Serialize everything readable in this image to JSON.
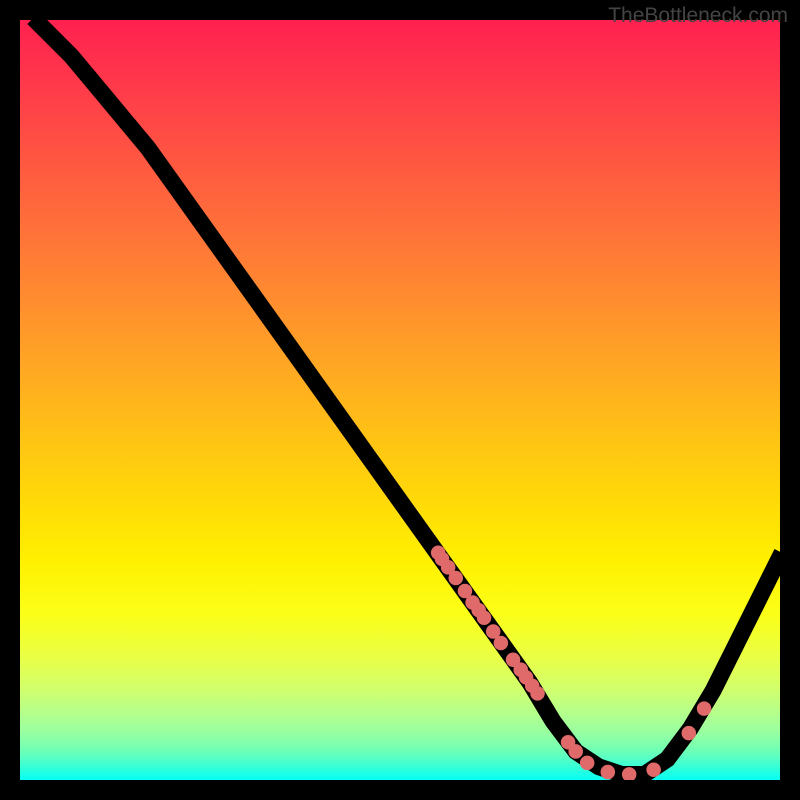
{
  "watermark": "TheBottleneck.com",
  "chart_data": {
    "type": "line",
    "title": "",
    "xlabel": "",
    "ylabel": "",
    "xlim": [
      0,
      100
    ],
    "ylim": [
      0,
      100
    ],
    "grid": false,
    "legend": false,
    "curve": [
      {
        "x": 2,
        "y": 100
      },
      {
        "x": 7,
        "y": 95
      },
      {
        "x": 12,
        "y": 89
      },
      {
        "x": 17,
        "y": 83
      },
      {
        "x": 22,
        "y": 76
      },
      {
        "x": 27,
        "y": 69
      },
      {
        "x": 32,
        "y": 62
      },
      {
        "x": 37,
        "y": 55
      },
      {
        "x": 42,
        "y": 48
      },
      {
        "x": 47,
        "y": 41
      },
      {
        "x": 52,
        "y": 34
      },
      {
        "x": 57,
        "y": 27
      },
      {
        "x": 62,
        "y": 20
      },
      {
        "x": 67,
        "y": 13
      },
      {
        "x": 70,
        "y": 8
      },
      {
        "x": 73,
        "y": 4
      },
      {
        "x": 76,
        "y": 2
      },
      {
        "x": 79,
        "y": 1
      },
      {
        "x": 82,
        "y": 1
      },
      {
        "x": 85,
        "y": 3
      },
      {
        "x": 88,
        "y": 7
      },
      {
        "x": 91,
        "y": 12
      },
      {
        "x": 94,
        "y": 18
      },
      {
        "x": 97,
        "y": 24
      },
      {
        "x": 100,
        "y": 30
      }
    ],
    "markers": [
      {
        "x": 55.0,
        "y": 30.0
      },
      {
        "x": 55.5,
        "y": 29.2
      },
      {
        "x": 56.3,
        "y": 28.1
      },
      {
        "x": 57.3,
        "y": 26.7
      },
      {
        "x": 58.5,
        "y": 25.0
      },
      {
        "x": 59.5,
        "y": 23.5
      },
      {
        "x": 60.3,
        "y": 22.5
      },
      {
        "x": 61.0,
        "y": 21.5
      },
      {
        "x": 62.2,
        "y": 19.7
      },
      {
        "x": 63.2,
        "y": 18.2
      },
      {
        "x": 64.8,
        "y": 16.0
      },
      {
        "x": 65.8,
        "y": 14.7
      },
      {
        "x": 66.5,
        "y": 13.7
      },
      {
        "x": 67.3,
        "y": 12.6
      },
      {
        "x": 68.0,
        "y": 11.6
      },
      {
        "x": 72.0,
        "y": 5.2
      },
      {
        "x": 73.0,
        "y": 4.0
      },
      {
        "x": 74.5,
        "y": 2.5
      },
      {
        "x": 77.2,
        "y": 1.3
      },
      {
        "x": 80.0,
        "y": 1.0
      },
      {
        "x": 83.2,
        "y": 1.6
      },
      {
        "x": 87.8,
        "y": 6.4
      },
      {
        "x": 89.8,
        "y": 9.6
      }
    ]
  }
}
